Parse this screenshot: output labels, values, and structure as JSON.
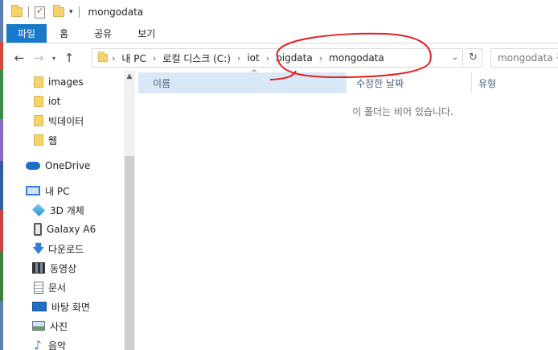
{
  "titlebar": {
    "title": "mongodata"
  },
  "ribbon": {
    "tabs": [
      "파일",
      "홈",
      "공유",
      "보기"
    ]
  },
  "address": {
    "crumbs": [
      "내 PC",
      "로컬 디스크 (C:)",
      "iot",
      "bigdata",
      "mongodata"
    ],
    "search_placeholder": "mongodata 검색"
  },
  "navpane": {
    "items": [
      {
        "label": "images",
        "icon": "folder-icon"
      },
      {
        "label": "iot",
        "icon": "folder-icon"
      },
      {
        "label": "빅데이터",
        "icon": "folder-icon"
      },
      {
        "label": "웹",
        "icon": "folder-icon"
      },
      {
        "label": "OneDrive",
        "icon": "onedrive-cloud-icon"
      },
      {
        "label": "내 PC",
        "icon": "this-pc-icon"
      },
      {
        "label": "3D 개체",
        "icon": "3d-objects-icon"
      },
      {
        "label": "Galaxy A6",
        "icon": "phone-icon"
      },
      {
        "label": "다운로드",
        "icon": "download-icon"
      },
      {
        "label": "동영상",
        "icon": "video-icon"
      },
      {
        "label": "문서",
        "icon": "documents-icon"
      },
      {
        "label": "바탕 화면",
        "icon": "desktop-icon"
      },
      {
        "label": "사진",
        "icon": "pictures-icon"
      },
      {
        "label": "음악",
        "icon": "music-icon"
      }
    ]
  },
  "content": {
    "columns": {
      "name": "이름",
      "date": "수정한 날짜",
      "type": "유형"
    },
    "empty_message": "이 폴더는 비어 있습니다."
  },
  "colors": {
    "file_tab": "#1979ca",
    "header_selected": "#d9e8f7",
    "annotation": "#e02020"
  }
}
